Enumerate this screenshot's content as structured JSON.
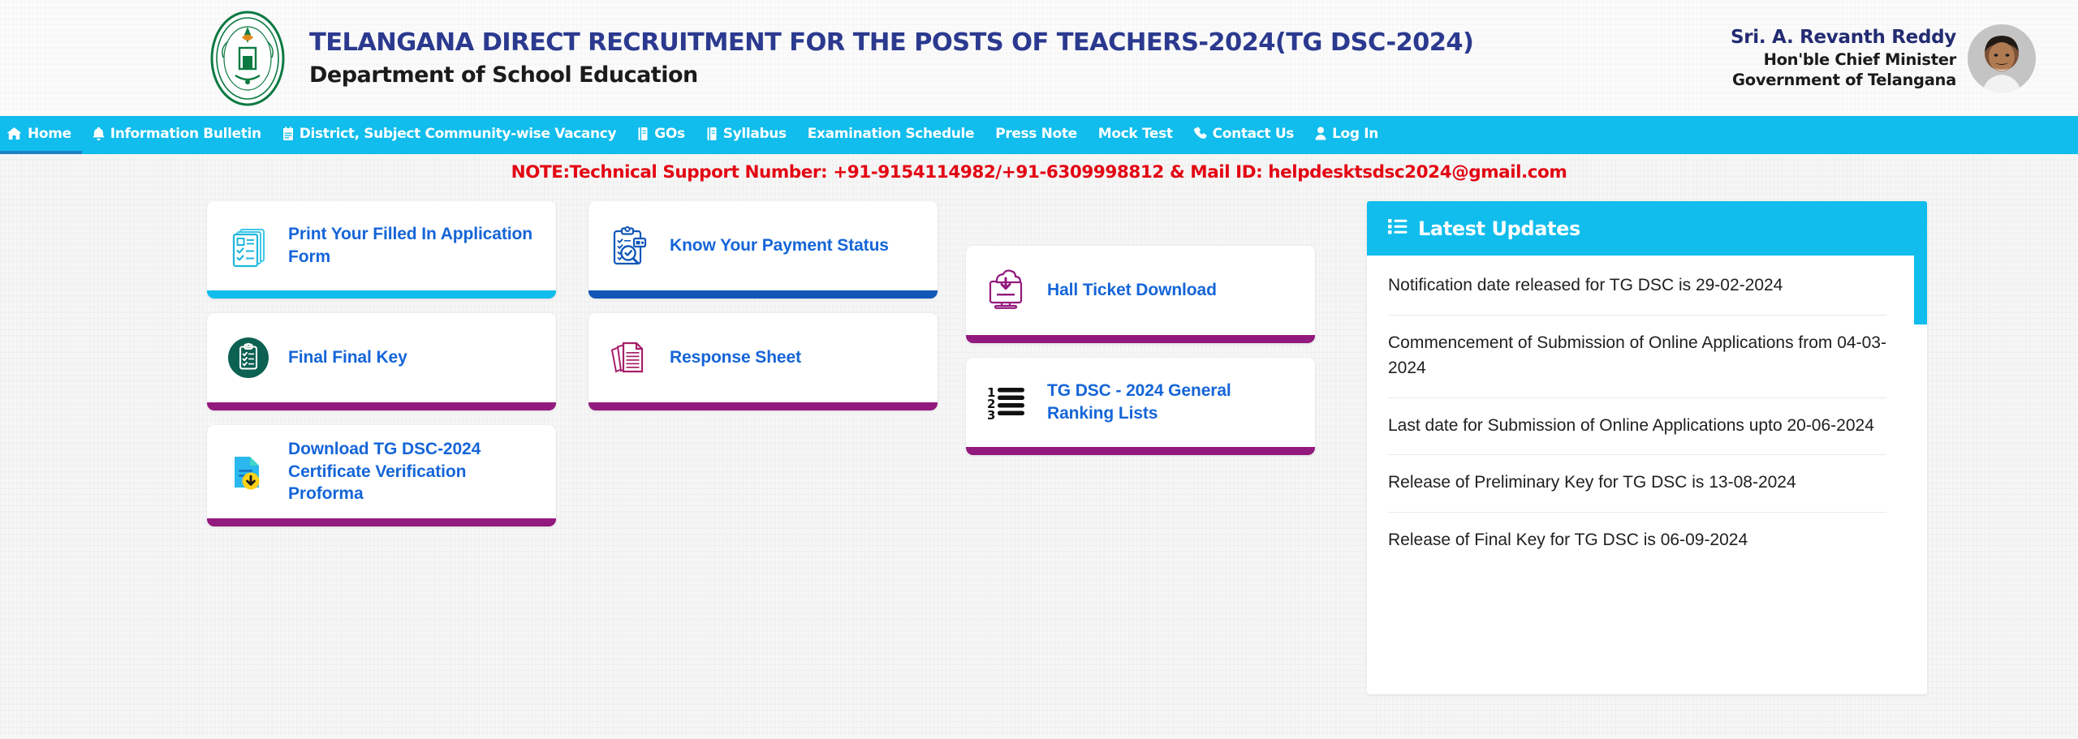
{
  "header": {
    "emblem_icon": "telangana-state-emblem",
    "title_main": "TELANGANA DIRECT RECRUITMENT FOR THE POSTS OF TEACHERS-2024(TG DSC-2024)",
    "title_sub": "Department of School Education",
    "cm_name": "Sri. A. Revanth Reddy",
    "cm_role": "Hon'ble Chief Minister",
    "cm_gov": "Government of Telangana",
    "cm_photo_icon": "chief-minister-portrait"
  },
  "nav": {
    "active_index": 0,
    "items": [
      {
        "label": "Home",
        "icon": "home-icon"
      },
      {
        "label": "Information Bulletin",
        "icon": "bell-icon"
      },
      {
        "label": "District, Subject Community-wise Vacancy",
        "icon": "calendar-icon"
      },
      {
        "label": "GOs",
        "icon": "book-icon"
      },
      {
        "label": "Syllabus",
        "icon": "book-icon"
      },
      {
        "label": "Examination Schedule",
        "icon": "none"
      },
      {
        "label": "Press Note",
        "icon": "none"
      },
      {
        "label": "Mock Test",
        "icon": "none"
      },
      {
        "label": "Contact Us",
        "icon": "phone-icon"
      },
      {
        "label": "Log In",
        "icon": "user-icon"
      }
    ]
  },
  "note": {
    "text": "NOTE:Technical Support Number: +91-9154114982/+91-6309998812 & Mail ID: helpdesktsdsc2024@gmail.com",
    "color": "#e30613"
  },
  "cards": [
    {
      "label": "Print Your Filled In Application Form",
      "icon": "application-form-icon",
      "accent": "#10bdec"
    },
    {
      "label": "Know Your Payment Status",
      "icon": "payment-status-clipboard-icon",
      "accent": "#1257b8"
    },
    {
      "label": "Hall Ticket Download",
      "icon": "monitor-cloud-download-icon",
      "accent": "#92197d"
    },
    {
      "label": "Final Final Key",
      "icon": "clipboard-check-circle-icon",
      "accent": "#92197d"
    },
    {
      "label": "Response Sheet",
      "icon": "document-stack-icon",
      "accent": "#92197d"
    },
    {
      "label": "TG DSC - 2024 General Ranking Lists",
      "icon": "numbered-list-icon",
      "accent": "#92197d"
    },
    {
      "label": "Download TG DSC-2024 Certificate Verification Proforma",
      "icon": "file-download-icon",
      "accent": "#92197d"
    }
  ],
  "updates": {
    "title": "Latest Updates",
    "icon": "list-icon",
    "accent": "#10bdec",
    "items": [
      "Notification date released for TG DSC is 29-02-2024",
      "Commencement of Submission of Online Applications from 04-03-2024",
      "Last date for Submission of Online Applications upto 20-06-2024",
      "Release of Preliminary Key for TG DSC is 13-08-2024",
      "Release of Final Key for TG DSC is 06-09-2024"
    ]
  }
}
